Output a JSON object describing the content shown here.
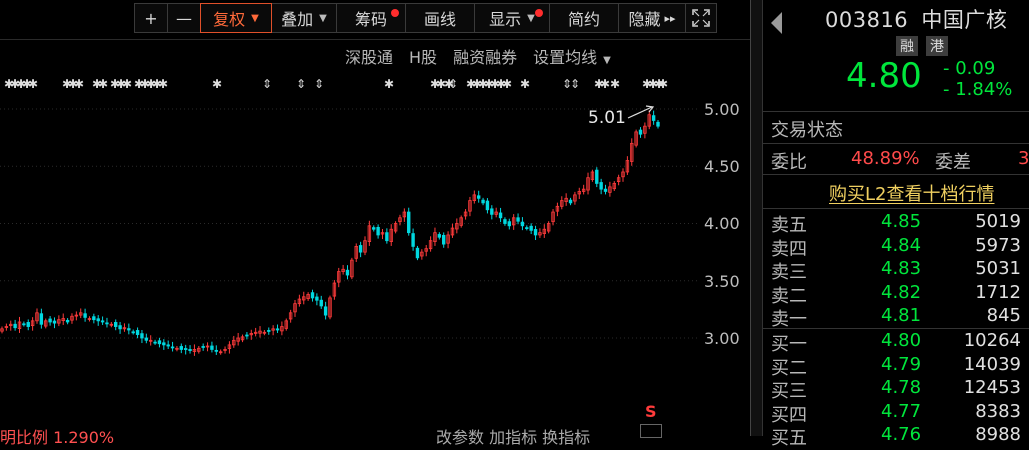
{
  "toolbar": {
    "plus": "+",
    "minus": "—",
    "fuquan": "复权",
    "diejia": "叠加",
    "chouma": "筹码",
    "huaxian": "画线",
    "xianshi": "显示",
    "jianyue": "简约",
    "yincang": "隐藏",
    "more": "▸▸"
  },
  "sublinks": {
    "sgt": "深股通",
    "hgu": "H股",
    "rzrq": "融资融券",
    "sjx": "设置均线"
  },
  "chart": {
    "price_labels": [
      "5.00",
      "4.50",
      "4.00",
      "3.50",
      "3.00"
    ],
    "high_label": "5.01",
    "s_icon": "S"
  },
  "chart_data": {
    "type": "candlestick",
    "y_ticks": [
      5.0,
      4.5,
      4.0,
      3.5,
      3.0
    ],
    "ylim": [
      2.55,
      5.18
    ],
    "annotation_high": 5.01,
    "closes": [
      3.08,
      3.1,
      3.12,
      3.09,
      3.14,
      3.12,
      3.1,
      3.15,
      3.22,
      3.12,
      3.15,
      3.14,
      3.13,
      3.16,
      3.17,
      3.14,
      3.19,
      3.2,
      3.22,
      3.18,
      3.17,
      3.16,
      3.15,
      3.14,
      3.13,
      3.12,
      3.1,
      3.08,
      3.09,
      3.07,
      3.05,
      3.03,
      3.0,
      2.98,
      2.98,
      2.96,
      2.95,
      2.94,
      2.93,
      2.92,
      2.91,
      2.9,
      2.9,
      2.89,
      2.9,
      2.91,
      2.92,
      2.93,
      2.9,
      2.89,
      2.88,
      2.9,
      2.94,
      2.98,
      3.0,
      3.01,
      3.02,
      3.04,
      3.05,
      3.06,
      3.05,
      3.06,
      3.08,
      3.07,
      3.1,
      3.15,
      3.22,
      3.3,
      3.34,
      3.36,
      3.38,
      3.35,
      3.33,
      3.28,
      3.2,
      3.35,
      3.48,
      3.58,
      3.6,
      3.55,
      3.68,
      3.8,
      3.75,
      3.85,
      3.98,
      3.95,
      3.9,
      3.92,
      3.85,
      3.95,
      4.0,
      4.05,
      4.1,
      3.92,
      3.8,
      3.7,
      3.75,
      3.78,
      3.85,
      3.92,
      3.88,
      3.82,
      3.9,
      3.96,
      4.0,
      4.05,
      4.1,
      4.2,
      4.25,
      4.22,
      4.18,
      4.12,
      4.08,
      4.1,
      4.05,
      4.0,
      3.98,
      4.05,
      4.02,
      3.98,
      3.96,
      3.94,
      3.9,
      3.92,
      3.95,
      4.0,
      4.1,
      4.15,
      4.2,
      4.22,
      4.18,
      4.25,
      4.28,
      4.3,
      4.4,
      4.45,
      4.35,
      4.3,
      4.28,
      4.32,
      4.35,
      4.4,
      4.45,
      4.55,
      4.7,
      4.8,
      4.78,
      4.85,
      4.95,
      4.9,
      4.85
    ]
  },
  "panel": {
    "code": "003816",
    "name": "中国广核",
    "badge1": "融",
    "badge2": "港",
    "price": "4.80",
    "change": "- 0.09",
    "change_pct": "- 1.84%",
    "status": "交易状态",
    "weibi_label": "委比",
    "weibi_value": "48.89%",
    "weicha_label": "委差",
    "weicha_value": "3",
    "l2_link": "购买L2查看十档行情",
    "sell": [
      {
        "label": "卖五",
        "price": "4.85",
        "vol": "5019"
      },
      {
        "label": "卖四",
        "price": "4.84",
        "vol": "5973"
      },
      {
        "label": "卖三",
        "price": "4.83",
        "vol": "5031"
      },
      {
        "label": "卖二",
        "price": "4.82",
        "vol": "1712"
      },
      {
        "label": "卖一",
        "price": "4.81",
        "vol": "845"
      }
    ],
    "buy": [
      {
        "label": "买一",
        "price": "4.80",
        "vol": "10264"
      },
      {
        "label": "买二",
        "price": "4.79",
        "vol": "14039"
      },
      {
        "label": "买三",
        "price": "4.78",
        "vol": "12453"
      },
      {
        "label": "买四",
        "price": "4.77",
        "vol": "8383"
      },
      {
        "label": "买五",
        "price": "4.76",
        "vol": "8988"
      }
    ]
  },
  "bottom": {
    "left": "明比例 1.290%",
    "mid": "改参数  加指标  换指标",
    "colors": {
      "up": "#ff3b3b",
      "down": "#00d8e0",
      "accent": "#ff6a3a",
      "green": "#00e63c"
    }
  }
}
